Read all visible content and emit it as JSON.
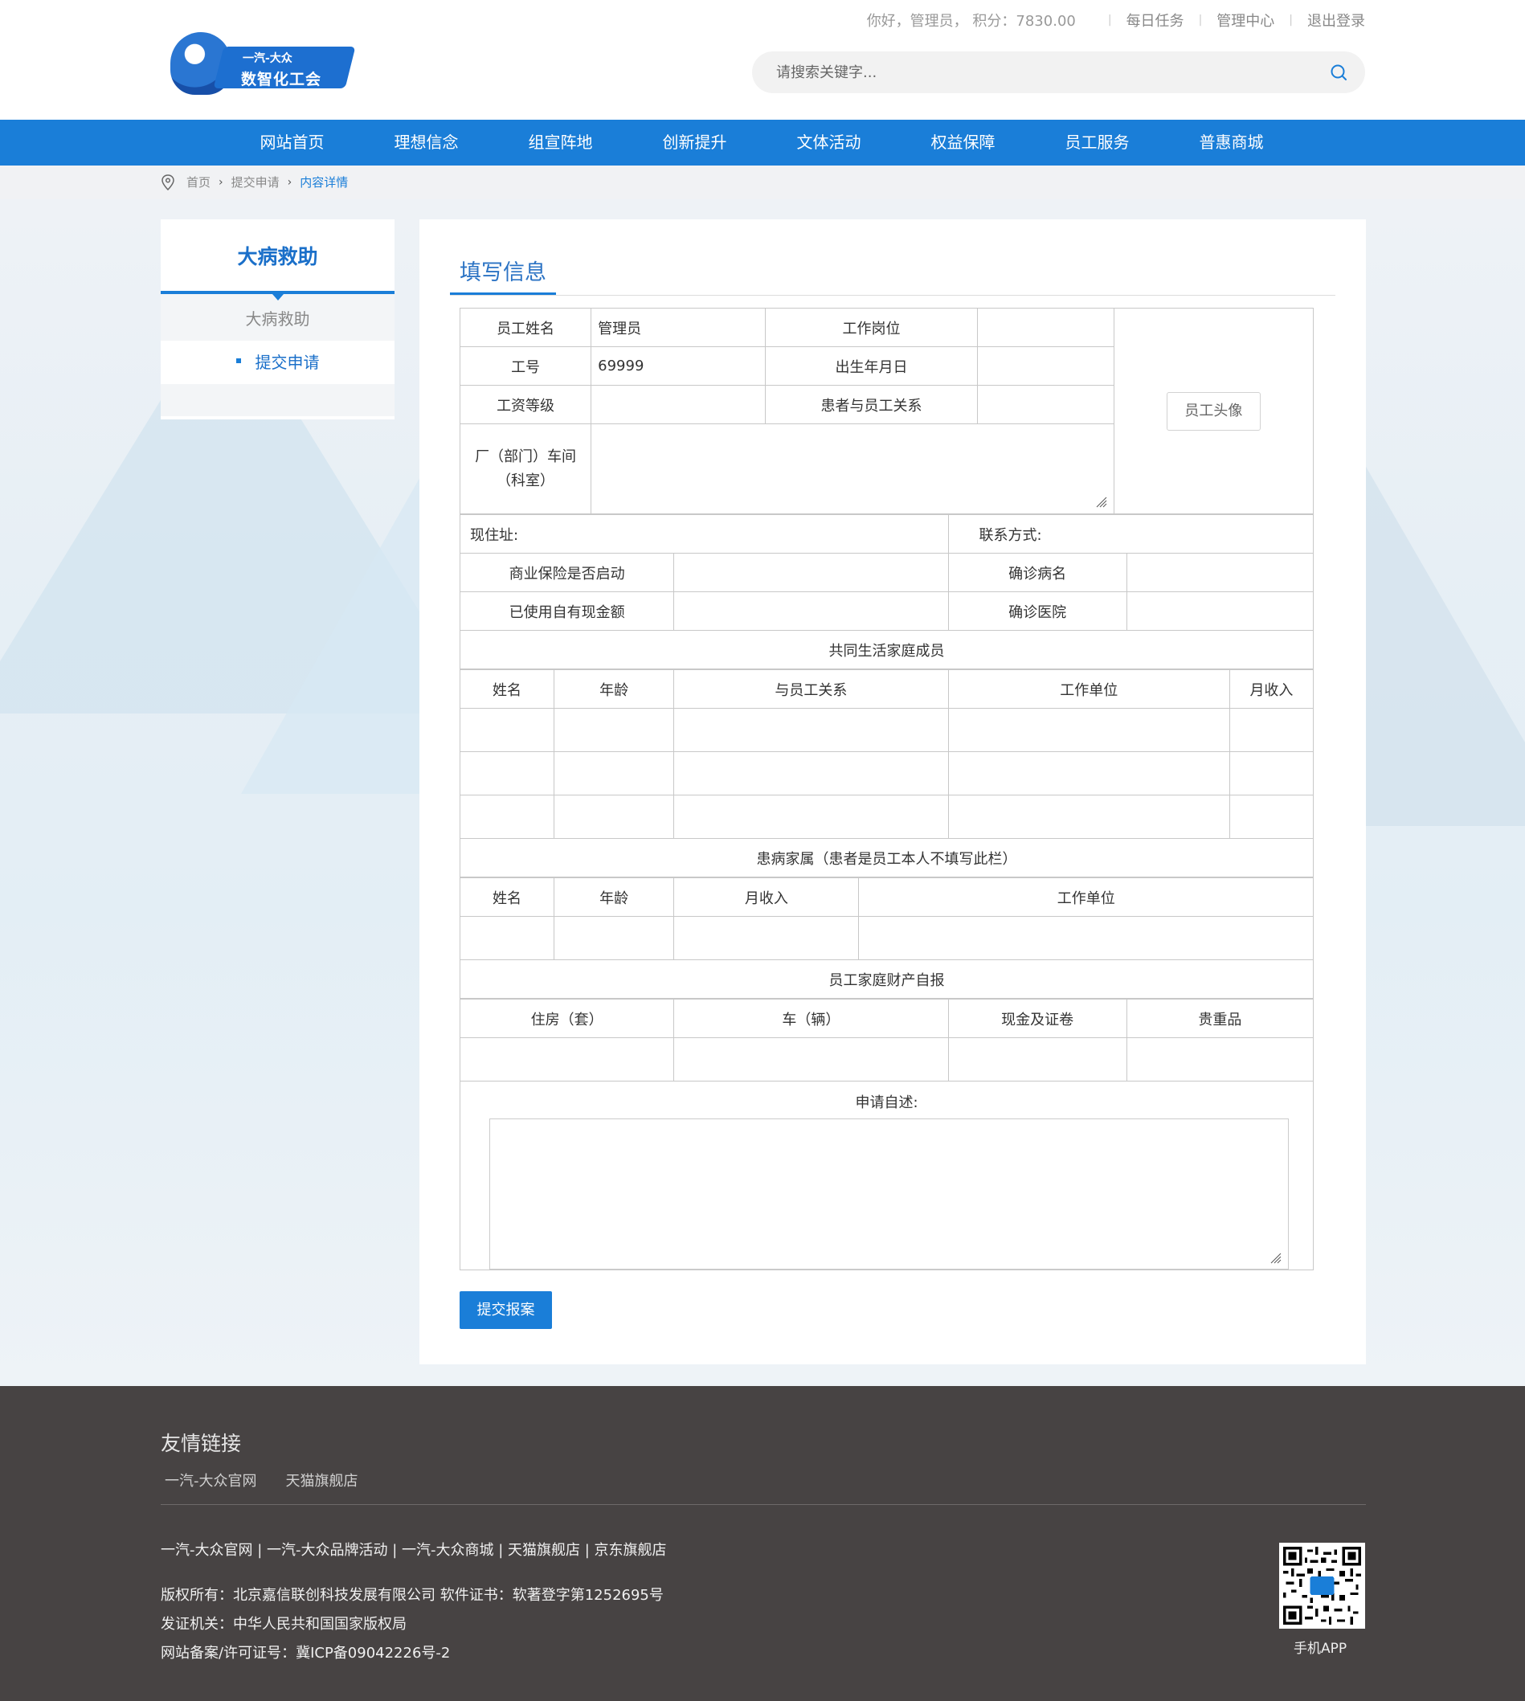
{
  "header": {
    "logo_brand": "一汽-大众",
    "logo_name": "数智化工会",
    "greeting": "你好，管理员， 积分：7830.00",
    "links": [
      "每日任务",
      "管理中心",
      "退出登录"
    ],
    "search_placeholder": "请搜索关键字..."
  },
  "nav": [
    "网站首页",
    "理想信念",
    "组宣阵地",
    "创新提升",
    "文体活动",
    "权益保障",
    "员工服务",
    "普惠商城"
  ],
  "breadcrumb": [
    "首页",
    "提交申请",
    "内容详情"
  ],
  "sidebar": {
    "title": "大病救助",
    "parent": "大病救助",
    "child": "提交申请"
  },
  "panel": {
    "title": "填写信息",
    "fields": {
      "employee_name_label": "员工姓名",
      "employee_name": "管理员",
      "job_position_label": "工作岗位",
      "job_position": "",
      "employee_id_label": "工号",
      "employee_id": "69999",
      "birth_label": "出生年月日",
      "birth": "",
      "salary_grade_label": "工资等级",
      "salary_grade": "",
      "relation_label": "患者与员工关系",
      "relation": "",
      "dept_label": "厂（部门）车间（科室）",
      "dept": "",
      "avatar_button": "员工头像",
      "address_label": "现住址:",
      "contact_label": "联系方式:",
      "insurance_label": "商业保险是否启动",
      "diagnosis_label": "确诊病名",
      "cash_used_label": "已使用自有现金额",
      "hospital_label": "确诊医院"
    },
    "family_section": "共同生活家庭成员",
    "family_headers": [
      "姓名",
      "年龄",
      "与员工关系",
      "工作单位",
      "月收入"
    ],
    "patient_family_section": "患病家属（患者是员工本人不填写此栏）",
    "patient_family_headers": [
      "姓名",
      "年龄",
      "月收入",
      "工作单位"
    ],
    "assets_section": "员工家庭财产自报",
    "assets_headers": [
      "住房（套）",
      "车（辆）",
      "现金及证卷",
      "贵重品"
    ],
    "statement_label": "申请自述:",
    "submit_label": "提交报案"
  },
  "footer": {
    "title": "友情链接",
    "links": [
      "一汽-大众官网",
      "天猫旗舰店"
    ],
    "line1": "一汽-大众官网 | 一汽-大众品牌活动 | 一汽-大众商城 | 天猫旗舰店 | 京东旗舰店",
    "line2": "版权所有：北京嘉信联创科技发展有限公司 软件证书：软著登字第1252695号",
    "line3": "发证机关：中华人民共和国国家版权局",
    "line4": "网站备案/许可证号：冀ICP备09042226号-2",
    "qr_label": "手机APP"
  },
  "colors": {
    "accent": "#1a7ed8",
    "footer_bg": "#474343"
  }
}
